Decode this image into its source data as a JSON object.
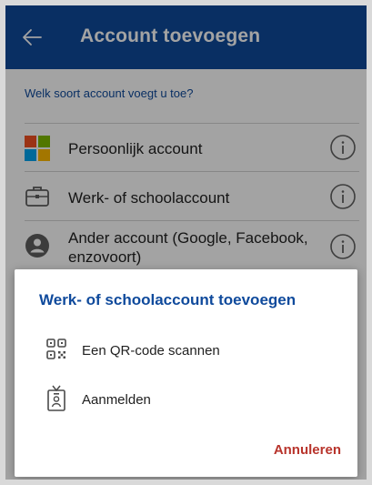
{
  "appbar": {
    "title": "Account toevoegen",
    "back_icon": "arrow-left-icon"
  },
  "prompt": "Welk soort account voegt u toe?",
  "accounts": [
    {
      "label": "Persoonlijk account",
      "icon": "microsoft-logo-icon"
    },
    {
      "label": "Werk- of schoolaccount",
      "icon": "briefcase-icon"
    },
    {
      "label_line1": "Ander account (Google, Facebook,",
      "label_line2": "enzovoort)",
      "icon": "person-icon"
    }
  ],
  "info_icon": "info-icon",
  "dialog": {
    "title": "Werk- of schoolaccount toevoegen",
    "options": [
      {
        "label": "Een QR-code scannen",
        "icon": "qr-code-icon"
      },
      {
        "label": "Aanmelden",
        "icon": "id-badge-icon"
      }
    ],
    "cancel_label": "Annuleren"
  },
  "colors": {
    "brand_blue": "#0f4a9c",
    "cancel_red": "#b8342c",
    "ms_red": "#f25022",
    "ms_green": "#7fba00",
    "ms_blue": "#00a4ef",
    "ms_yellow": "#ffb900"
  }
}
